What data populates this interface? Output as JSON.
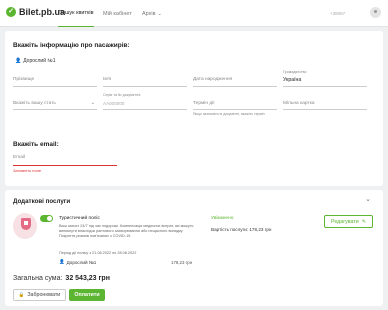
{
  "header": {
    "logo": "Bilet.pb.ua",
    "nav": [
      "Пошук квитків",
      "Мій кабінет",
      "Архів"
    ],
    "phone": "+38067"
  },
  "passenger": {
    "title": "Вкажіть інформацію про пасажирів:",
    "passenger_label": "Дорослий №1",
    "surname_label": "Прізвище",
    "name_label": "Ім'я",
    "birthdate_label": "Дата народження",
    "citizenship_label": "Громадянство",
    "citizenship_value": "Україна",
    "doctype_label": "Вкажіть вашу стать",
    "docnum_top": "Серія та № документа",
    "docnum_placeholder": "АА000000",
    "expiry_label": "Термін дії",
    "expiry_hint": "Якщо зазначено в документі, вкажіть термін",
    "card_label": "Мільна картка"
  },
  "email": {
    "title": "Вкажіть email:",
    "label": "Email",
    "error": "Заповніть поле"
  },
  "services": {
    "title": "Додаткові послуги",
    "insurance_title": "Туристичний поліс",
    "insurance_desc": "Ваш захист 24/7 під час подорожі. Компенсація медичних витрат, які можуть виникнути внаслідок раптового захворювання або нещасного випадку. Покриття ризиків пов'язаних з COVID-19.",
    "period": "Період дії полісу з 21.08.2022 по 28.08.2022",
    "status": "Увімкнено",
    "cost_label": "Вартість послуги: 178,23 грн",
    "edit_button": "Редагувати",
    "passenger_label": "Дорослий №1",
    "passenger_price": "178,23 грн"
  },
  "summary": {
    "total_label": "Загальна сума:",
    "total_value": "32 543,23 грн",
    "reserve_button": "Забронювати",
    "pay_button": "Оплатити"
  }
}
